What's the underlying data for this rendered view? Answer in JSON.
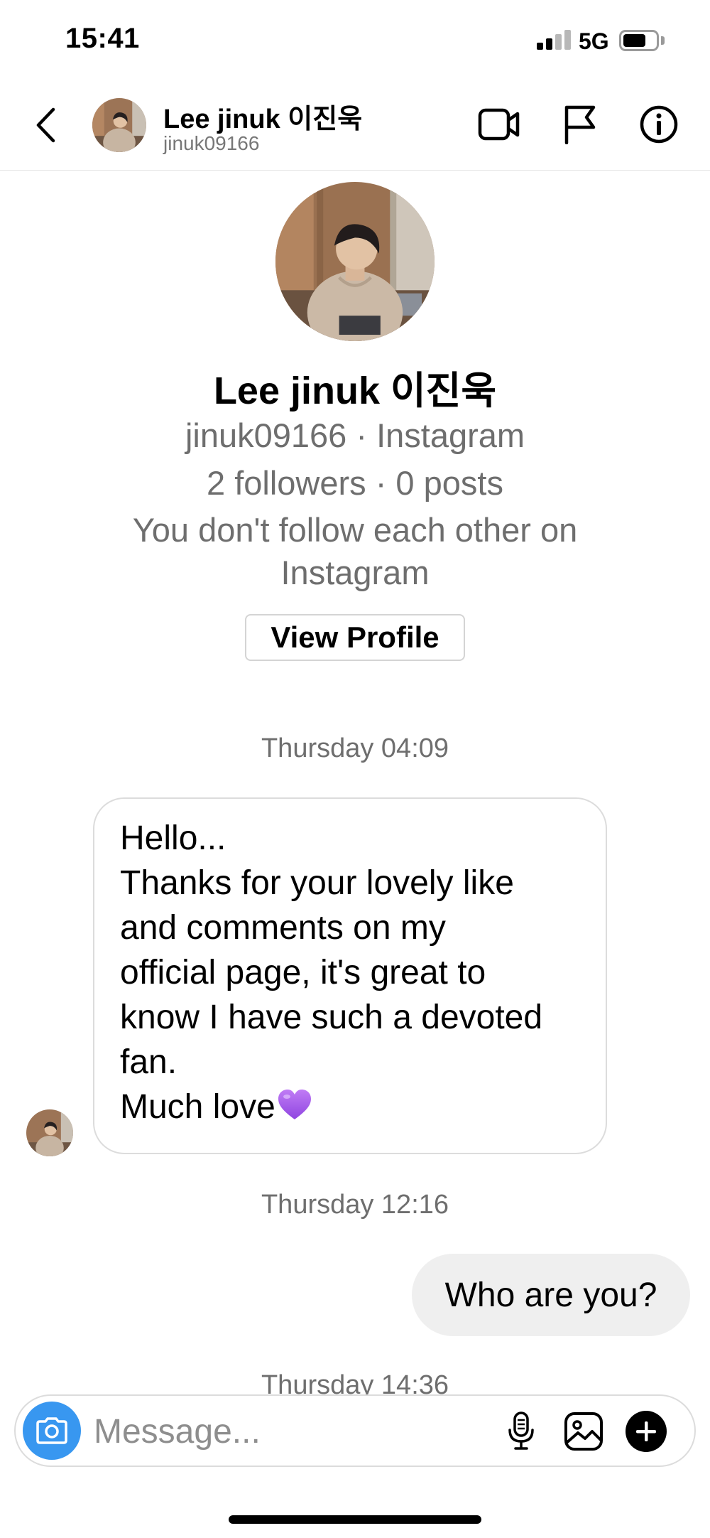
{
  "status_bar": {
    "time": "15:41",
    "network": "5G",
    "signal_bars_active": 2,
    "signal_bars_total": 4,
    "battery_level": 0.7
  },
  "header": {
    "name": "Lee jinuk 이진욱",
    "handle": "jinuk09166",
    "icons": [
      "back-chevron-icon",
      "video-call-icon",
      "flag-icon",
      "info-icon"
    ]
  },
  "profile": {
    "name": "Lee jinuk 이진욱",
    "handle_platform": "jinuk09166 · Instagram",
    "stats": "2 followers · 0 posts",
    "relationship_line1": "You don't follow each other on",
    "relationship_line2": "Instagram",
    "view_profile_label": "View Profile"
  },
  "conversation": {
    "messages": [
      {
        "timestamp": "Thursday 04:09",
        "direction": "incoming",
        "lines": [
          "Hello...",
          "Thanks for your lovely like",
          "and comments on my",
          "official page, it's great to",
          "know I have such a devoted",
          "fan.",
          "Much love"
        ],
        "emoji": "purple-heart"
      },
      {
        "timestamp": "Thursday 12:16",
        "direction": "outgoing",
        "text": "Who are you?"
      }
    ],
    "partial_timestamp": "Thursday 14:36"
  },
  "composer": {
    "placeholder": "Message...",
    "icons": [
      "camera-icon",
      "microphone-icon",
      "gallery-icon",
      "add-icon"
    ]
  },
  "colors": {
    "accent_blue": "#3897f0",
    "secondary_text": "#6e6e6e",
    "outgoing_bubble": "#efefef",
    "heart_purple": "#a35ee8"
  }
}
